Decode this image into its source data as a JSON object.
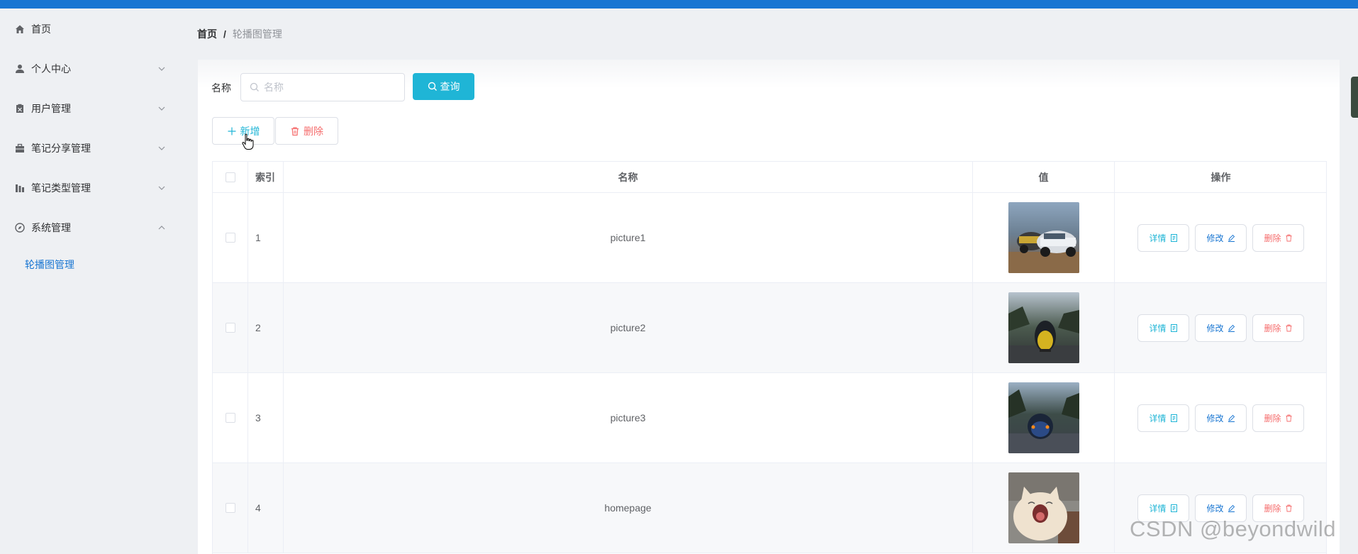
{
  "sidebar": {
    "items": [
      {
        "label": "首页",
        "icon": "home-icon",
        "expandable": false
      },
      {
        "label": "个人中心",
        "icon": "user-icon",
        "expandable": true
      },
      {
        "label": "用户管理",
        "icon": "clipboard-icon",
        "expandable": true
      },
      {
        "label": "笔记分享管理",
        "icon": "briefcase-icon",
        "expandable": true
      },
      {
        "label": "笔记类型管理",
        "icon": "chart-icon",
        "expandable": true
      },
      {
        "label": "系统管理",
        "icon": "compass-icon",
        "expandable": true,
        "expanded": true
      }
    ],
    "submenu": {
      "label": "轮播图管理",
      "active": true
    }
  },
  "breadcrumb": {
    "home": "首页",
    "separator": "/",
    "current": "轮播图管理"
  },
  "search": {
    "label": "名称",
    "placeholder": "名称",
    "value": "",
    "query_label": "查询"
  },
  "actions": {
    "add_label": "新增",
    "delete_label": "删除"
  },
  "table": {
    "headers": {
      "index": "索引",
      "name": "名称",
      "value": "值",
      "ops": "操作"
    },
    "rows": [
      {
        "index": "1",
        "name": "picture1",
        "value_image": "cars-race-photo"
      },
      {
        "index": "2",
        "name": "picture2",
        "value_image": "yellow-car-photo"
      },
      {
        "index": "3",
        "name": "picture3",
        "value_image": "blue-car-photo"
      },
      {
        "index": "4",
        "name": "homepage",
        "value_image": "yawning-cat-photo"
      }
    ],
    "row_actions": {
      "detail": "详情",
      "edit": "修改",
      "delete": "删除"
    }
  },
  "watermark": "CSDN @beyondwild",
  "colors": {
    "primary": "#1976d2",
    "accent": "#1fb5d6",
    "danger": "#f56c6c"
  }
}
